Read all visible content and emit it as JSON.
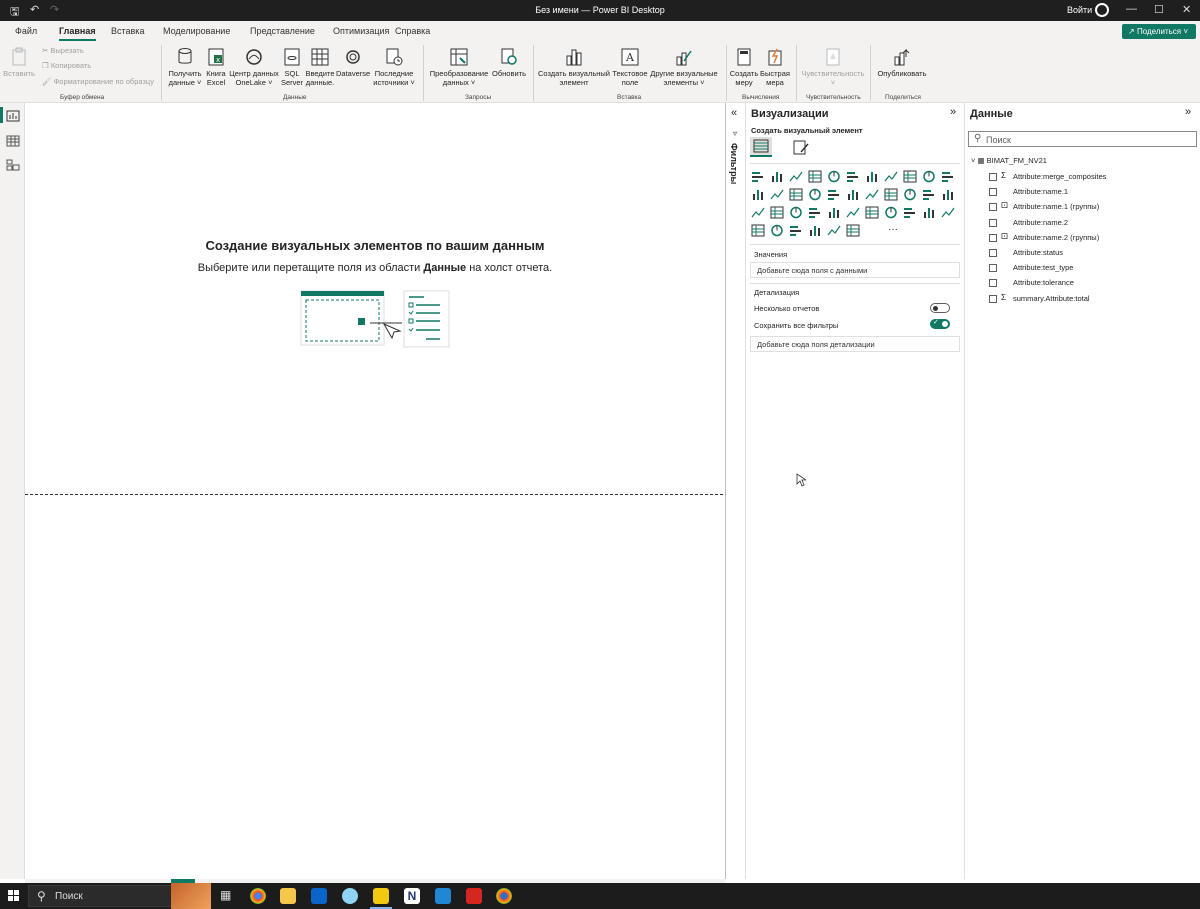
{
  "window": {
    "title": "Без имени — Power BI Desktop",
    "signin": "Войти"
  },
  "menu": {
    "tabs": [
      "Файл",
      "Главная",
      "Вставка",
      "Моделирование",
      "Представление",
      "Оптимизация",
      "Справка"
    ],
    "active": "Главная",
    "share": "Поделиться"
  },
  "ribbon": {
    "paste": "Вставить",
    "cut": "Вырезать",
    "copy": "Копировать",
    "format_painter": "Форматирование по образцу",
    "clipboard_group": "Буфер обмена",
    "get_data": "Получить данные",
    "excel": "Книга Excel",
    "onelake": "Центр данных OneLake",
    "sql": "SQL Server",
    "enter_data": "Введите данные.",
    "dataverse": "Dataverse",
    "recent": "Последние источники",
    "data_group": "Данные",
    "transform": "Преобразование данных",
    "refresh": "Обновить",
    "queries_group": "Запросы",
    "new_visual": "Создать визуальный элемент",
    "textbox": "Текстовое поле",
    "more_visuals": "Другие визуальные элементы",
    "insert_group": "Вставка",
    "new_measure": "Создать меру",
    "quick_measure": "Быстрая мера",
    "calc_group": "Вычисления",
    "sensitivity": "Чувствительность",
    "sensitivity_group": "Чувствительность",
    "publish": "Опубликовать",
    "share_group": "Поделиться"
  },
  "canvas": {
    "heading": "Создание визуальных элементов по вашим данным",
    "sub_before": "Выберите или перетащите поля из области ",
    "sub_bold": "Данные",
    "sub_after": " на холст отчета."
  },
  "filters": {
    "label": "Фильтры"
  },
  "viz": {
    "title": "Визуализации",
    "build": "Создать визуальный элемент",
    "values_label": "Значения",
    "values_placeholder": "Добавьте сюда поля с данными",
    "drill_label": "Детализация",
    "cross_report": "Несколько отчетов",
    "keep_filters": "Сохранить все фильтры",
    "drill_placeholder": "Добавьте сюда поля детализации",
    "more": "···"
  },
  "data": {
    "title": "Данные",
    "search_placeholder": "Поиск",
    "table": "BIMAT_FM_NV21",
    "fields": [
      {
        "label": "Attribute:merge_composites",
        "icon": "sigma"
      },
      {
        "label": "Attribute:name.1",
        "icon": "none"
      },
      {
        "label": "Attribute:name.1 (группы)",
        "icon": "group"
      },
      {
        "label": "Attribute:name.2",
        "icon": "none"
      },
      {
        "label": "Attribute:name.2 (группы)",
        "icon": "group"
      },
      {
        "label": "Attribute:status",
        "icon": "none"
      },
      {
        "label": "Attribute:test_type",
        "icon": "none"
      },
      {
        "label": "Attribute:tolerance",
        "icon": "none"
      },
      {
        "label": "summary.Attribute:total",
        "icon": "sigma"
      }
    ]
  },
  "taskbar": {
    "search": "Поиск"
  },
  "colors": {
    "accent": "#117865",
    "titlebar": "#1f1f1f",
    "ribbon": "#f3f2f1"
  }
}
